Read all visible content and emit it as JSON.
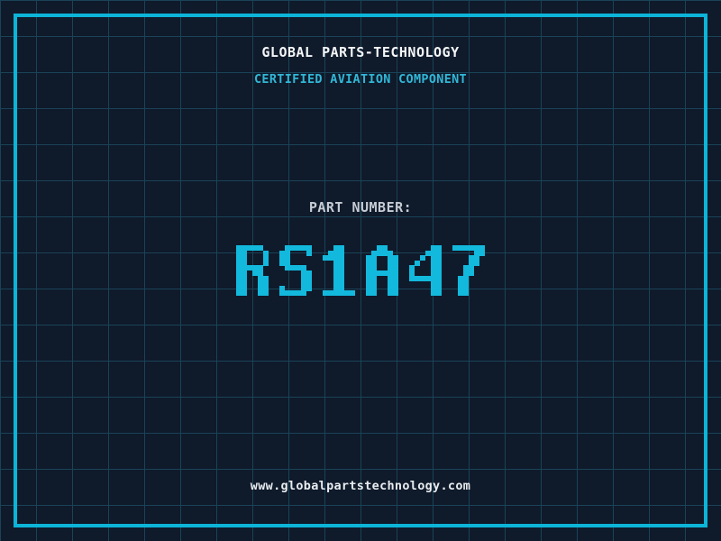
{
  "header": {
    "title": "GLOBAL PARTS-TECHNOLOGY",
    "subtitle": "CERTIFIED AVIATION COMPONENT"
  },
  "part": {
    "label": "PART NUMBER:",
    "value": "RS1A47"
  },
  "footer": {
    "url": "www.globalpartstechnology.com"
  },
  "colors": {
    "background": "#0f1a2b",
    "grid_line": "#1a4357",
    "frame": "#0cb4d8",
    "title": "#f4f6f8",
    "subtitle": "#31b7d6",
    "part_label": "#c6ccd4",
    "part_value": "#12b9dd",
    "footer": "#e8ecef"
  }
}
